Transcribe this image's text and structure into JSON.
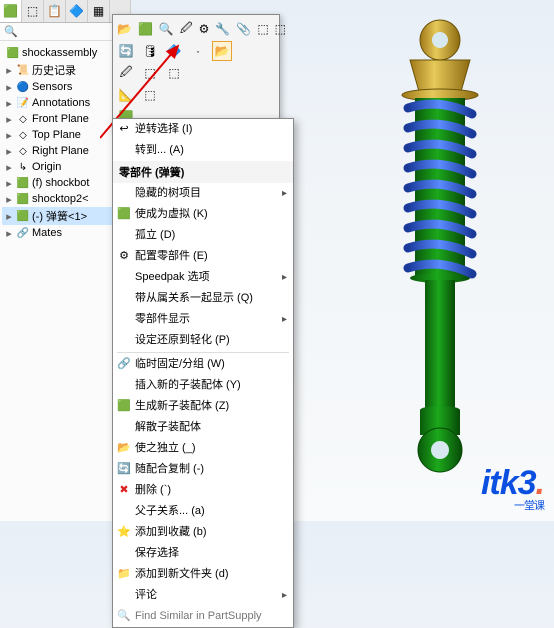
{
  "tree": {
    "root": "shockassembly",
    "items": [
      {
        "icon": "📜",
        "label": "历史记录"
      },
      {
        "icon": "🔵",
        "label": "Sensors"
      },
      {
        "icon": "📝",
        "label": "Annotations"
      },
      {
        "icon": "◇",
        "label": "Front Plane"
      },
      {
        "icon": "◇",
        "label": "Top Plane"
      },
      {
        "icon": "◇",
        "label": "Right Plane"
      },
      {
        "icon": "↳",
        "label": "Origin"
      },
      {
        "icon": "🟩",
        "label": "(f) shockbot"
      },
      {
        "icon": "🟩",
        "label": "shocktop2<"
      },
      {
        "icon": "🟩",
        "label": "(-) 弹簧<1>",
        "sel": true
      },
      {
        "icon": "🔗",
        "label": "Mates"
      }
    ]
  },
  "toolbar": {
    "rows": [
      [
        "📂",
        "🟩",
        "🔍",
        "🖉",
        "⚙",
        "🔧",
        "📎",
        "⬚",
        "⬚"
      ],
      [
        "🔄",
        "🛢",
        "🔷",
        "·",
        "📂"
      ],
      [
        "🖉",
        "⬚",
        "⬚"
      ],
      [
        "📐",
        "⬚"
      ],
      [
        "🟩"
      ]
    ],
    "highlight_index": [
      1,
      4
    ]
  },
  "contextMenu": {
    "title": "零部件 (弹簧)",
    "top": [
      {
        "icon": "↩",
        "label": "逆转选择 (I)"
      },
      {
        "icon": "",
        "label": "转到... (A)"
      }
    ],
    "items": [
      {
        "icon": "",
        "label": "隐藏的树项目",
        "sub": true
      },
      {
        "icon": "🟩",
        "label": "使成为虚拟 (K)"
      },
      {
        "icon": "",
        "label": "孤立 (D)"
      },
      {
        "icon": "⚙",
        "label": "配置零部件 (E)"
      },
      {
        "icon": "",
        "label": "Speedpak 选项",
        "sub": true
      },
      {
        "icon": "",
        "label": "带从属关系一起显示 (Q)"
      },
      {
        "icon": "",
        "label": "零部件显示",
        "sub": true
      },
      {
        "icon": "",
        "label": "设定还原到轻化 (P)"
      },
      {
        "sep": true
      },
      {
        "icon": "🔗",
        "label": "临时固定/分组 (W)"
      },
      {
        "icon": "",
        "label": "插入新的子装配体 (Y)"
      },
      {
        "icon": "🟩",
        "label": "生成新子装配体 (Z)"
      },
      {
        "icon": "",
        "label": "解散子装配体"
      },
      {
        "icon": "📂",
        "label": "使之独立 (_)"
      },
      {
        "icon": "🔄",
        "label": "随配合复制 (-)"
      },
      {
        "icon": "✖",
        "label": "删除 (`)",
        "red": true
      },
      {
        "icon": "",
        "label": "父子关系... (a)"
      },
      {
        "icon": "⭐",
        "label": "添加到收藏 (b)"
      },
      {
        "icon": "",
        "label": "保存选择"
      },
      {
        "icon": "📁",
        "label": "添加到新文件夹 (d)"
      },
      {
        "icon": "",
        "label": "评论",
        "sub": true
      },
      {
        "icon": "🔍",
        "label": "Find Similar in PartSupply",
        "faded": true
      }
    ]
  },
  "watermark": {
    "text": "itk3",
    "dot": ".",
    "sub": "一堂课"
  }
}
